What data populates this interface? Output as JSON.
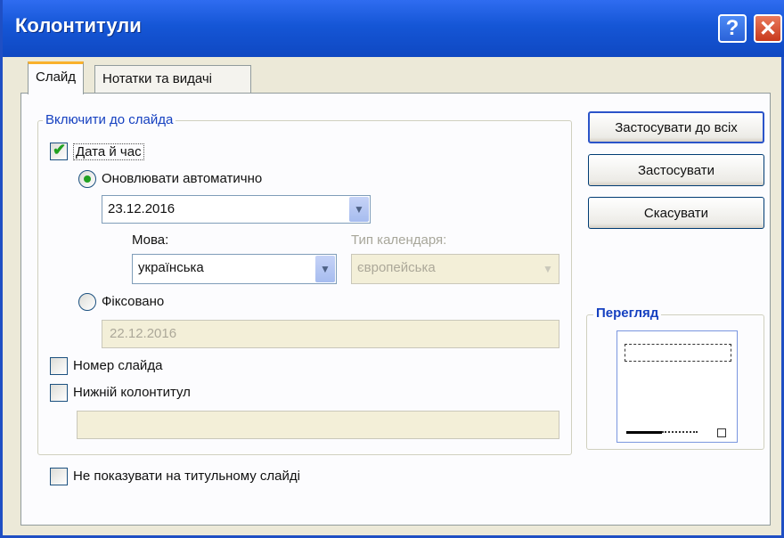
{
  "window": {
    "title": "Колонтитули",
    "help_label": "?",
    "close_label": "✕"
  },
  "tabs": [
    {
      "label": "Слайд",
      "active": true
    },
    {
      "label": "Нотатки та видачі",
      "active": false
    }
  ],
  "include_group": {
    "legend": "Включити до слайда",
    "date_time": {
      "label": "Дата й час",
      "checked": true
    },
    "auto_update": {
      "label": "Оновлювати автоматично",
      "selected": true
    },
    "auto_date_value": "23.12.2016",
    "language_label": "Мова:",
    "language_value": "українська",
    "calendar_label": "Тип календаря:",
    "calendar_value": "європейська",
    "fixed": {
      "label": "Фіксовано",
      "selected": false
    },
    "fixed_value": "22.12.2016",
    "slide_number": {
      "label": "Номер слайда",
      "checked": false
    },
    "footer": {
      "label": "Нижній колонтитул",
      "checked": false
    },
    "footer_value": ""
  },
  "hide_on_title": {
    "label": "Не показувати на титульному слайді",
    "checked": false
  },
  "buttons": {
    "apply_all": "Застосувати до всіх",
    "apply": "Застосувати",
    "cancel": "Скасувати"
  },
  "preview": {
    "legend": "Перегляд"
  },
  "icons": {
    "help": "help-icon",
    "close": "close-icon",
    "dropdown": "chevron-down-icon"
  },
  "colors": {
    "title_bar": "#1556d6",
    "accent_tab": "#f9b12c",
    "group_label": "#1540c0",
    "check": "#21a121"
  }
}
